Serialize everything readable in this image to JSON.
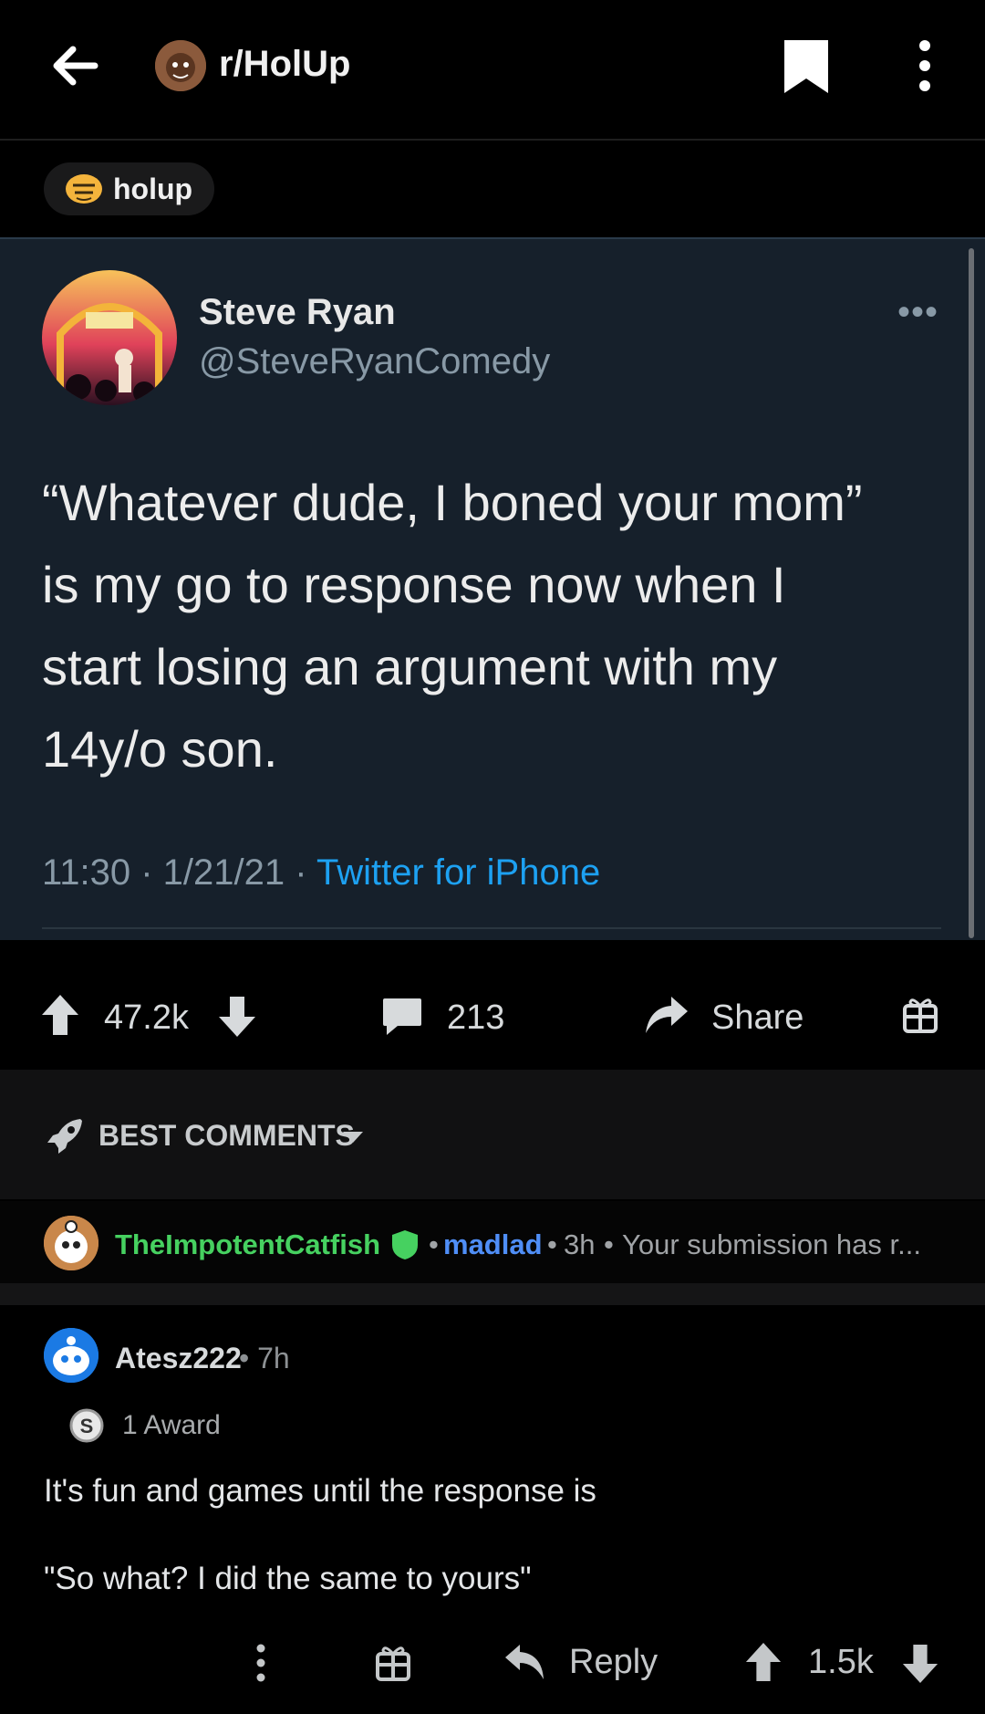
{
  "header": {
    "subreddit": "r/HolUp"
  },
  "post": {
    "flair": "holup"
  },
  "tweet": {
    "name": "Steve Ryan",
    "handle": "@SteveRyanComedy",
    "more": "•••",
    "lines": [
      "“Whatever dude, I boned your mom”",
      "is my go to response now when I",
      "start losing an argument with my",
      "14y/o son."
    ],
    "time": "11:30 · 1/21/21 · ",
    "source": "Twitter for iPhone"
  },
  "actions": {
    "votes": "47.2k",
    "comments": "213",
    "share": "Share"
  },
  "sort": {
    "label": "BEST COMMENTS"
  },
  "pinned_comment": {
    "username": "TheImpotentCatfish",
    "sep1": "•",
    "flair": "madlad",
    "sep2": "•",
    "age": "3h",
    "sep3": "•",
    "preview": "Your submission has r..."
  },
  "comment": {
    "username": "Atesz222",
    "age": "• 7h",
    "awards": "1 Award",
    "body_line1": "It's fun and games until the response is",
    "body_line2": "\"So what? I did the same to yours\"",
    "reply": "Reply",
    "votes": "1.5k"
  },
  "colors": {
    "background": "#000000",
    "tweet_bg": "#16202b",
    "mod_green": "#46d160",
    "flair_blue": "#4f8ef7",
    "twitter_blue": "#1da1f2"
  }
}
